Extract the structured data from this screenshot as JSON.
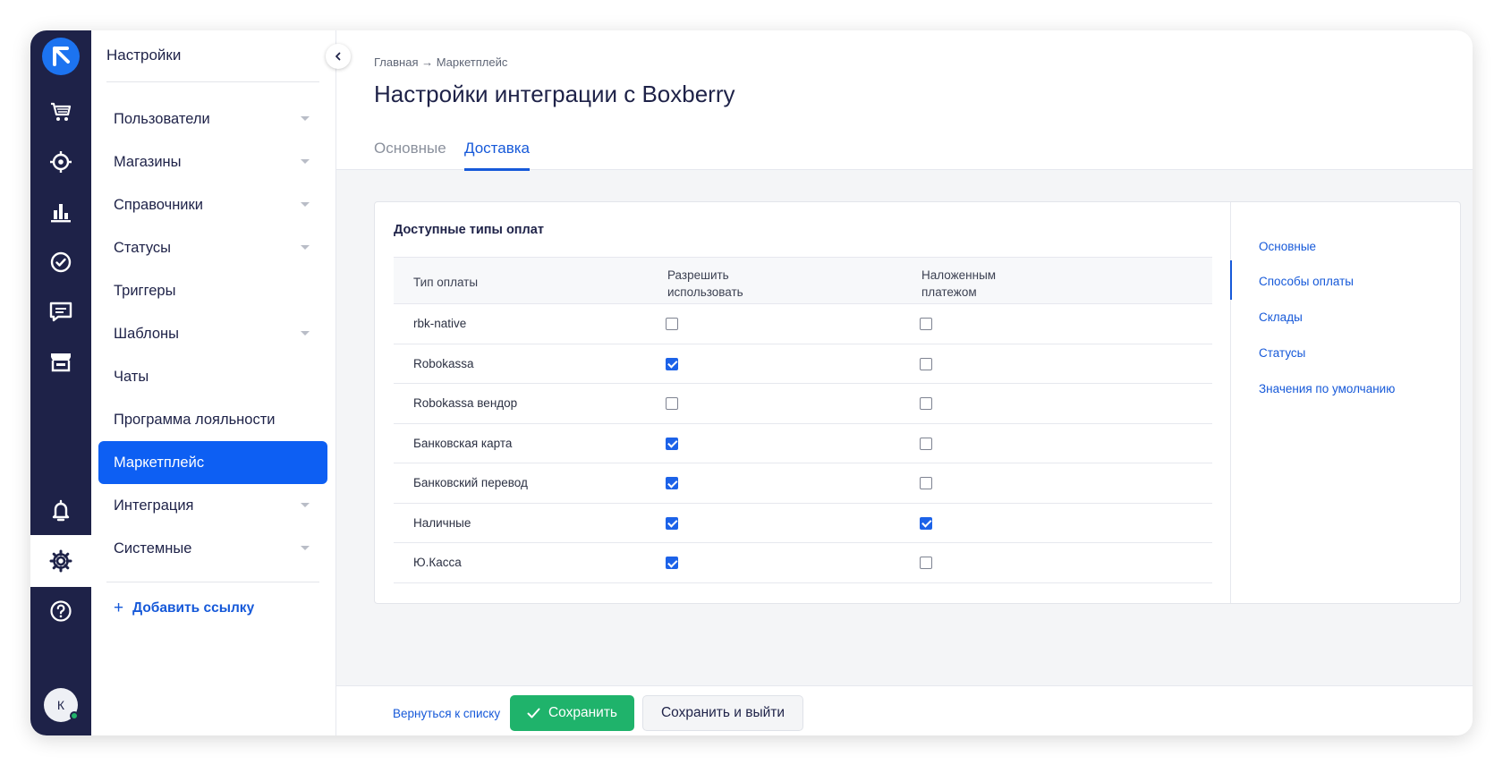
{
  "rail": {
    "icons": [
      "logo-icon",
      "cart-icon",
      "target-icon",
      "chart-icon",
      "check-circle-icon",
      "chat-icon",
      "store-icon",
      "bell-icon",
      "gear-icon",
      "help-icon"
    ],
    "avatar_initial": "К"
  },
  "sidebar": {
    "title": "Настройки",
    "items": [
      {
        "label": "Пользователи",
        "has_submenu": true
      },
      {
        "label": "Магазины",
        "has_submenu": true
      },
      {
        "label": "Справочники",
        "has_submenu": true
      },
      {
        "label": "Статусы",
        "has_submenu": true
      },
      {
        "label": "Триггеры",
        "has_submenu": false
      },
      {
        "label": "Шаблоны",
        "has_submenu": true
      },
      {
        "label": "Чаты",
        "has_submenu": false
      },
      {
        "label": "Программа лояльности",
        "has_submenu": false
      },
      {
        "label": "Маркетплейс",
        "has_submenu": false,
        "active": true
      },
      {
        "label": "Интеграция",
        "has_submenu": true
      },
      {
        "label": "Системные",
        "has_submenu": true
      }
    ],
    "add_link_plus": "+",
    "add_link_label": "Добавить ссылку"
  },
  "header": {
    "breadcrumb": "Главная → Маркетплейс",
    "title": "Настройки интеграции с Boxberry",
    "tabs": [
      {
        "label": "Основные",
        "active": false
      },
      {
        "label": "Доставка",
        "active": true
      }
    ]
  },
  "payment_section": {
    "title": "Доступные типы оплат",
    "columns": [
      "Тип оплаты",
      "Разрешить\nиспользовать",
      "Наложенным\nплатежом"
    ],
    "rows": [
      {
        "name": "rbk-native",
        "allow": false,
        "cod": false
      },
      {
        "name": "Robokassa",
        "allow": true,
        "cod": false
      },
      {
        "name": "Robokassa вендор",
        "allow": false,
        "cod": false
      },
      {
        "name": "Банковская карта",
        "allow": true,
        "cod": false
      },
      {
        "name": "Банковский перевод",
        "allow": true,
        "cod": false
      },
      {
        "name": "Наличные",
        "allow": true,
        "cod": true
      },
      {
        "name": "Ю.Касса",
        "allow": true,
        "cod": false
      }
    ]
  },
  "anchor_nav": {
    "links": [
      "Основные",
      "Способы оплаты",
      "Склады",
      "Статусы",
      "Значения по умолчанию"
    ],
    "active_index": 1
  },
  "footer": {
    "back_label": "Вернуться к списку",
    "save_label": "Сохранить",
    "save_exit_label": "Сохранить и выйти"
  },
  "colors": {
    "rail_bg": "#1e2248",
    "accent": "#0d5ff3",
    "save_green": "#1fb36b"
  }
}
